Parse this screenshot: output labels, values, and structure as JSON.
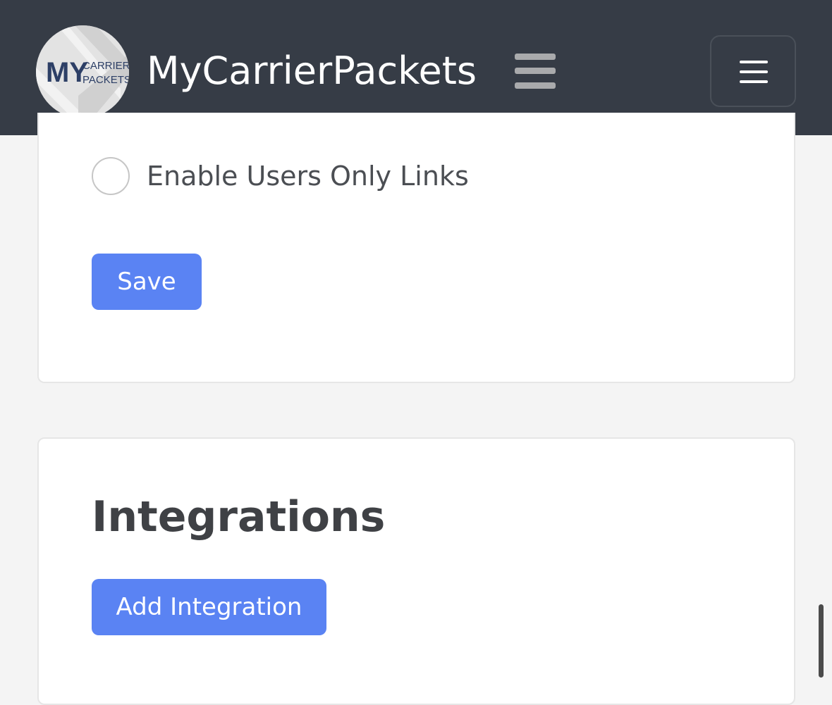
{
  "header": {
    "logo": {
      "alt": "MY CARRIER PACKETS logo",
      "text_main": "MY",
      "text_line1": "CARRIER",
      "text_line2": "PACKETS"
    },
    "brand_name": "MyCarrierPackets",
    "sidebar_toggle_icon": "hamburger-icon",
    "menu_toggle_icon": "menu-icon"
  },
  "settings_card": {
    "radio_option": {
      "label": "Enable Users Only Links",
      "checked": false
    },
    "save_label": "Save"
  },
  "integrations_card": {
    "title": "Integrations",
    "add_button_label": "Add Integration"
  },
  "colors": {
    "navbar_bg": "#363c46",
    "page_bg": "#f4f4f4",
    "primary_button": "#5a83f3",
    "heading_text": "#3f4145",
    "body_text": "#4b4e53"
  }
}
